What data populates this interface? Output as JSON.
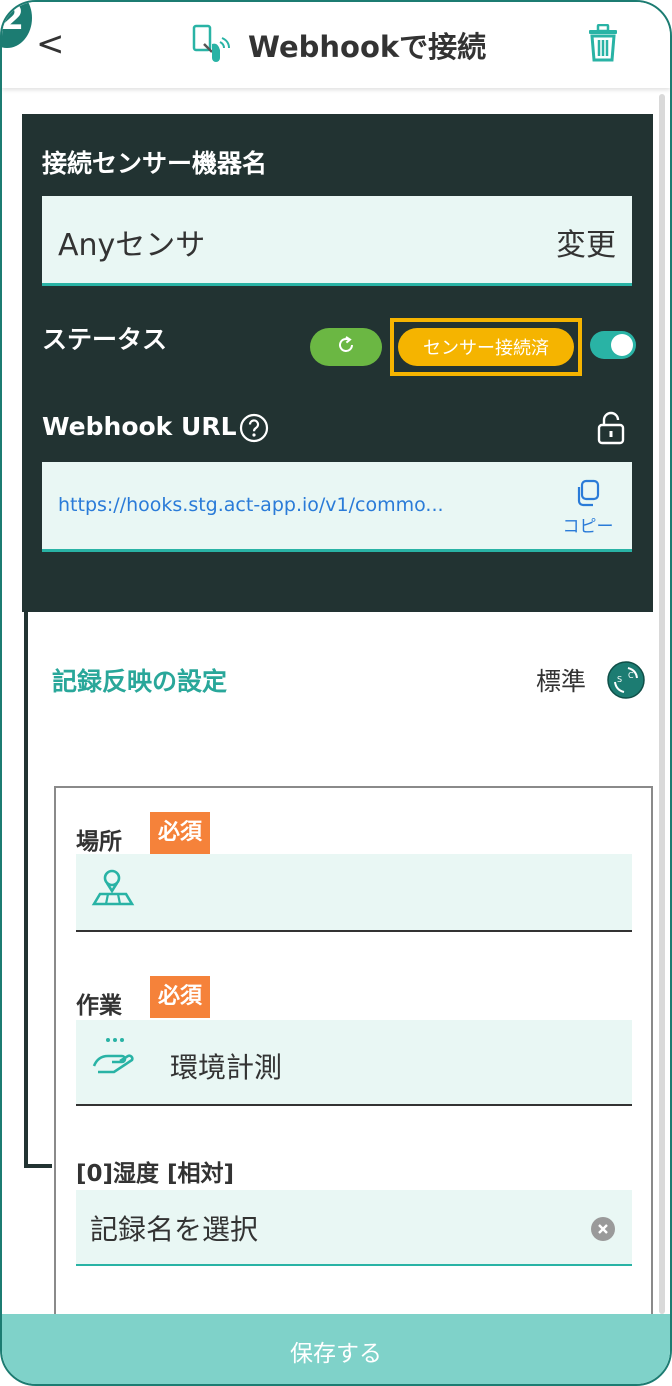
{
  "step_badge": "2",
  "header": {
    "back_icon": "chevron-left-icon",
    "title_icon": "sensor-icon",
    "title": "Webhookで接続",
    "trash_icon": "trash-icon"
  },
  "sensor": {
    "name_label": "接続センサー機器名",
    "name_value": "Anyセンサ",
    "change_label": "変更",
    "status_label": "ステータス",
    "status_value": "センサー接続済",
    "toggle_on": true,
    "webhook_label": "Webhook URL",
    "webhook_url": "https://hooks.stg.act-app.io/v1/commo...",
    "copy_label": "コピー"
  },
  "record": {
    "section_title": "記録反映の設定",
    "mode_label": "標準",
    "fields": {
      "place_label": "場所",
      "place_required": "必須",
      "work_label": "作業",
      "work_required": "必須",
      "work_value": "環境計測",
      "humidity_label": "[0]湿度 [相対]",
      "humidity_placeholder": "記録名を選択"
    }
  },
  "footer": {
    "save_label": "保存する"
  },
  "colors": {
    "panel": "#223332",
    "accent": "#29b3a5",
    "status": "#f5b400",
    "required": "#f5823a",
    "refresh": "#6bb743",
    "save_bar": "#7fd2c9"
  }
}
